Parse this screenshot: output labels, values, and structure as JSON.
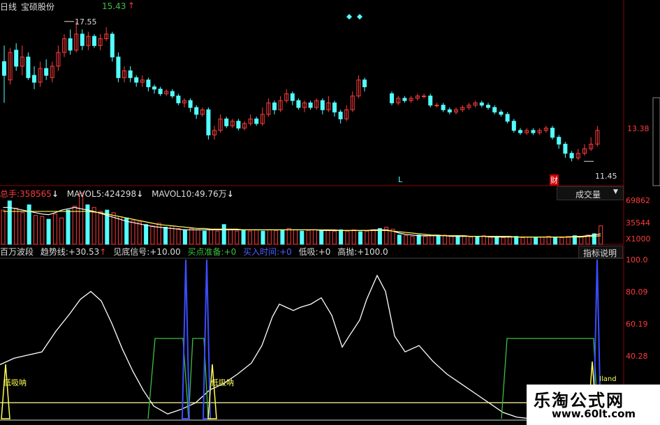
{
  "header": {
    "period": "日线",
    "stock": "宝硕股份",
    "price": "15.43",
    "arrow": "↑"
  },
  "price_pane": {
    "high_label": "17.55",
    "low_label": "11.45",
    "axis_label": "13.38",
    "marker_l": "L",
    "marker_cai": "财"
  },
  "volume_pane": {
    "total_label": "总手:",
    "total_value": "358565",
    "total_arrow": "↓",
    "mavol5_label": "MAVOL5:",
    "mavol5_value": "424298",
    "mavol5_arrow": "↓",
    "mavol10_label": "MAVOL10:",
    "mavol10_value": "49.76万",
    "mavol10_arrow": "↓",
    "dropdown": "成交量",
    "dropdown_icon": "▼",
    "axis": [
      "69862",
      "35544",
      "X1000"
    ]
  },
  "indicator_pane": {
    "name": "百万波段",
    "trend_label": "趋势线:",
    "trend_value": "+30.53",
    "trend_arrow": "↑",
    "signal_label": "见底信号:",
    "signal_value": "+10.00",
    "prepare_label": "买点准备:",
    "prepare_value": "+0",
    "buytime_label": "买入时间:",
    "buytime_value": "+0",
    "low_label": "低吸:",
    "low_value": "+0",
    "high_label": "高抛:",
    "high_value": "+100.0",
    "explain_button": "指标说明",
    "axis": [
      "100.0",
      "80.09",
      "60.19",
      "40.28"
    ],
    "annot_1": "低吸呐",
    "annot_2": "低吸呐",
    "bottom_text": "Iland"
  },
  "watermark": {
    "line1": "乐淘公式网",
    "line2": "www.60lt.com"
  },
  "colors": {
    "up": "#ff3b3b",
    "down": "#54ffff",
    "white": "#ffffff",
    "yellow": "#ffff54",
    "blue": "#3b4dff",
    "green": "#3fbf3f",
    "grid": "#8b0000"
  },
  "chart_data": [
    {
      "type": "candlestick",
      "name": "price",
      "ylim": [
        11.0,
        18.0
      ],
      "annotations": [
        "17.55",
        "11.45",
        "L",
        "财"
      ],
      "axis_ticks": [
        "13.38"
      ],
      "segment_a": [
        [
          15.8,
          15.2,
          16.5,
          14.0
        ],
        [
          15.0,
          16.2,
          16.4,
          14.8
        ],
        [
          16.3,
          15.6,
          16.6,
          15.4
        ],
        [
          15.6,
          16.0,
          16.5,
          15.2
        ],
        [
          16.0,
          15.1,
          16.2,
          15.0
        ],
        [
          15.2,
          14.9,
          15.6,
          14.6
        ],
        [
          14.9,
          15.5,
          15.8,
          14.7
        ],
        [
          15.5,
          15.2,
          15.9,
          15.0
        ],
        [
          15.1,
          15.6,
          15.8,
          14.9
        ],
        [
          15.6,
          16.2,
          16.5,
          15.4
        ],
        [
          16.2,
          16.8,
          17.0,
          16.0
        ],
        [
          16.8,
          16.3,
          17.2,
          16.1
        ],
        [
          16.3,
          17.0,
          17.55,
          16.2
        ],
        [
          17.0,
          16.5,
          17.2,
          16.3
        ],
        [
          16.5,
          16.9,
          17.1,
          16.3
        ],
        [
          16.9,
          16.5,
          17.0,
          16.4
        ],
        [
          16.5,
          16.8,
          17.0,
          16.3
        ],
        [
          16.8,
          17.0,
          17.3,
          16.7
        ],
        [
          17.0,
          16.0,
          17.1,
          15.8
        ],
        [
          16.0,
          15.1,
          16.2,
          14.9
        ],
        [
          15.1,
          15.4,
          15.6,
          14.9
        ],
        [
          15.4,
          15.1,
          15.6,
          14.9
        ],
        [
          15.1,
          14.9,
          15.2,
          14.7
        ],
        [
          14.9,
          15.0,
          15.2,
          14.7
        ],
        [
          15.0,
          14.7,
          15.1,
          14.5
        ],
        [
          14.7,
          14.6,
          14.8,
          14.4
        ],
        [
          14.6,
          14.4,
          14.7,
          14.3
        ],
        [
          14.4,
          14.5,
          14.6,
          14.3
        ],
        [
          14.5,
          14.3,
          14.6,
          14.2
        ],
        [
          14.3,
          14.0,
          14.4,
          13.9
        ],
        [
          14.0,
          14.1,
          14.2,
          13.8
        ],
        [
          14.1,
          13.8,
          14.2,
          13.6
        ],
        [
          13.8,
          13.5,
          13.9,
          13.3
        ],
        [
          13.5,
          13.7,
          13.8,
          13.4
        ],
        [
          13.7,
          12.6,
          13.8,
          12.4
        ],
        [
          12.6,
          12.8,
          13.0,
          12.4
        ],
        [
          12.8,
          13.3,
          13.5,
          12.7
        ],
        [
          13.3,
          13.0,
          13.4,
          12.9
        ],
        [
          13.0,
          13.2,
          13.3,
          12.9
        ],
        [
          13.2,
          12.9,
          13.3,
          12.8
        ],
        [
          12.9,
          13.1,
          13.2,
          12.8
        ],
        [
          13.1,
          13.3,
          13.5,
          13.0
        ],
        [
          13.3,
          13.1,
          13.4,
          13.0
        ],
        [
          13.1,
          13.5,
          13.8,
          13.0
        ],
        [
          13.5,
          14.0,
          14.2,
          13.4
        ],
        [
          14.0,
          13.7,
          14.1,
          13.5
        ],
        [
          13.7,
          14.1,
          14.3,
          13.6
        ],
        [
          14.1,
          14.4,
          14.6,
          14.0
        ],
        [
          14.4,
          14.1,
          14.5,
          13.9
        ],
        [
          14.1,
          13.8,
          14.2,
          13.7
        ],
        [
          13.8,
          14.0,
          14.1,
          13.6
        ],
        [
          14.0,
          13.8,
          14.1,
          13.7
        ],
        [
          13.8,
          14.1,
          14.2,
          13.7
        ],
        [
          14.1,
          13.7,
          14.2,
          13.5
        ],
        [
          13.7,
          14.0,
          14.3,
          13.6
        ],
        [
          14.0,
          13.6,
          14.1,
          13.4
        ],
        [
          13.6,
          13.3,
          13.7,
          13.1
        ],
        [
          13.3,
          13.7,
          13.9,
          13.2
        ],
        [
          13.7,
          14.3,
          14.5,
          13.6
        ],
        [
          14.3,
          15.0,
          15.2,
          14.2
        ],
        [
          15.0,
          14.7,
          15.1,
          14.5
        ]
      ],
      "segment_b": [
        [
          14.4,
          14.0,
          14.5,
          13.9
        ],
        [
          14.0,
          14.2,
          14.3,
          13.9
        ],
        [
          14.2,
          14.1,
          14.3,
          14.0
        ],
        [
          14.1,
          14.2,
          14.3,
          14.0
        ],
        [
          14.2,
          14.3,
          14.4,
          14.1
        ],
        [
          14.3,
          14.3,
          14.4,
          14.2
        ],
        [
          14.3,
          13.9,
          14.4,
          13.8
        ],
        [
          13.9,
          13.9,
          14.0,
          13.8
        ],
        [
          13.9,
          13.7,
          14.0,
          13.6
        ],
        [
          13.7,
          13.6,
          13.8,
          13.5
        ],
        [
          13.6,
          13.7,
          13.8,
          13.5
        ],
        [
          13.7,
          13.8,
          13.9,
          13.6
        ],
        [
          13.8,
          13.9,
          14.0,
          13.7
        ],
        [
          13.9,
          14.0,
          14.1,
          13.8
        ],
        [
          14.0,
          13.9,
          14.1,
          13.8
        ],
        [
          13.9,
          13.8,
          14.0,
          13.7
        ],
        [
          13.8,
          13.6,
          13.9,
          13.5
        ],
        [
          13.6,
          13.5,
          13.7,
          13.4
        ],
        [
          13.5,
          13.2,
          13.6,
          13.1
        ],
        [
          13.2,
          12.8,
          13.3,
          12.7
        ],
        [
          12.8,
          12.7,
          12.9,
          12.6
        ],
        [
          12.7,
          12.8,
          12.9,
          12.6
        ],
        [
          12.8,
          12.7,
          12.9,
          12.6
        ],
        [
          12.7,
          12.8,
          12.9,
          12.6
        ],
        [
          12.8,
          12.9,
          13.0,
          12.7
        ],
        [
          12.9,
          12.5,
          13.0,
          12.4
        ],
        [
          12.5,
          12.2,
          12.6,
          12.0
        ],
        [
          12.2,
          11.8,
          12.3,
          11.6
        ],
        [
          11.8,
          11.6,
          11.9,
          11.45
        ],
        [
          11.6,
          11.8,
          12.0,
          11.5
        ],
        [
          11.8,
          12.0,
          12.2,
          11.7
        ],
        [
          12.0,
          12.2,
          12.5,
          11.9
        ],
        [
          12.2,
          12.8,
          13.0,
          12.1
        ]
      ]
    },
    {
      "type": "bar",
      "name": "volume",
      "ylim": [
        0,
        85000
      ],
      "axis_ticks": [
        "69862",
        "35544",
        "X1000"
      ],
      "values": [
        52000,
        66000,
        55000,
        48000,
        60000,
        44000,
        42000,
        38000,
        46000,
        40000,
        52000,
        58000,
        78000,
        60000,
        56000,
        50000,
        52000,
        48000,
        42000,
        40000,
        36000,
        34000,
        30000,
        28000,
        32000,
        26000,
        28000,
        24000,
        22000,
        24000,
        22000,
        20000,
        22000,
        20000,
        30000,
        22000,
        20000,
        22000,
        20000,
        22000,
        20000,
        22000,
        21000,
        22000,
        24000,
        22000,
        20000,
        21000,
        22000,
        20000,
        21000,
        20000,
        22000,
        20000,
        22000,
        19000,
        20000,
        22000,
        24000,
        26000,
        23000,
        14000,
        13000,
        12000,
        14000,
        12000,
        13000,
        12000,
        14000,
        12000,
        13000,
        12000,
        11000,
        12000,
        13000,
        11000,
        12000,
        10000,
        11000,
        12000,
        10000,
        11000,
        10000,
        11000,
        12000,
        11000,
        10000,
        12000,
        13000,
        11000,
        14000,
        16000,
        28000
      ],
      "mavol5": [
        56000,
        56000,
        54000,
        52000,
        50000,
        48000,
        46000,
        45000,
        48000,
        52000,
        54000,
        56000,
        54000,
        52000,
        50000,
        47000,
        44000,
        41000,
        38000,
        35000,
        33000,
        31000,
        29000,
        27000,
        26000,
        25000,
        24000,
        23000,
        22000,
        22000,
        22000,
        22000,
        22000,
        22000,
        22000,
        22000,
        22000,
        22000,
        22000,
        22000,
        22000,
        22000,
        22000,
        22000,
        22000,
        22000,
        22000,
        22000,
        22000,
        21000,
        21000,
        21000,
        21000,
        21000,
        21000,
        21000,
        21000,
        22000,
        22000,
        22000,
        20000,
        17000,
        15000,
        14000,
        13000,
        13000,
        13000,
        13000,
        13000,
        12000,
        12000,
        12000,
        12000,
        12000,
        12000,
        11000,
        11000,
        11000,
        11000,
        11000,
        11000,
        11000,
        11000,
        11000,
        11000,
        11000,
        11000,
        11000,
        12000,
        12000,
        13000,
        14000,
        16000
      ],
      "mavol10": [
        50000,
        50000,
        50000,
        50000,
        50000,
        50000,
        50000,
        50000,
        50000,
        50000,
        50000,
        50000,
        50000,
        50000,
        49000,
        48000,
        46000,
        44000,
        42000,
        40000,
        38000,
        36000,
        34000,
        32000,
        30000,
        29000,
        28000,
        27000,
        26000,
        25000,
        24000,
        24000,
        23000,
        23000,
        23000,
        23000,
        23000,
        22000,
        22000,
        22000,
        22000,
        22000,
        22000,
        22000,
        22000,
        22000,
        22000,
        22000,
        22000,
        22000,
        22000,
        22000,
        21000,
        21000,
        21000,
        21000,
        21000,
        21000,
        21000,
        21000,
        20000,
        19000,
        18000,
        17000,
        16000,
        15000,
        14000,
        14000,
        13000,
        13000,
        13000,
        13000,
        12000,
        12000,
        12000,
        12000,
        12000,
        12000,
        12000,
        11000,
        11000,
        11000,
        11000,
        11000,
        11000,
        11000,
        11000,
        11000,
        11000,
        11000,
        12000,
        12000,
        13000
      ]
    },
    {
      "type": "line",
      "name": "百万波段",
      "ylim": [
        0,
        100
      ],
      "axis_ticks": [
        "100.0",
        "80.09",
        "60.19",
        "40.28"
      ],
      "series": [
        {
          "name": "趋势线",
          "color": "#ffffff",
          "values": [
            [
              0,
              34
            ],
            [
              20,
              38
            ],
            [
              40,
              40
            ],
            [
              60,
              42
            ],
            [
              80,
              55
            ],
            [
              100,
              66
            ],
            [
              115,
              75
            ],
            [
              130,
              80
            ],
            [
              145,
              74
            ],
            [
              160,
              60
            ],
            [
              175,
              44
            ],
            [
              190,
              30
            ],
            [
              205,
              18
            ],
            [
              220,
              8
            ],
            [
              240,
              3
            ],
            [
              260,
              6
            ],
            [
              280,
              10
            ],
            [
              300,
              18
            ],
            [
              320,
              22
            ],
            [
              340,
              28
            ],
            [
              360,
              35
            ],
            [
              375,
              46
            ],
            [
              390,
              64
            ],
            [
              400,
              72
            ],
            [
              410,
              70
            ],
            [
              420,
              68
            ],
            [
              430,
              70
            ],
            [
              445,
              72
            ],
            [
              460,
              76
            ],
            [
              475,
              65
            ],
            [
              490,
              45
            ],
            [
              500,
              52
            ],
            [
              515,
              62
            ],
            [
              525,
              75
            ],
            [
              540,
              90
            ],
            [
              552,
              80
            ],
            [
              565,
              52
            ],
            [
              580,
              42
            ],
            [
              600,
              46
            ],
            [
              620,
              36
            ],
            [
              640,
              28
            ],
            [
              660,
              22
            ],
            [
              680,
              16
            ],
            [
              700,
              10
            ],
            [
              720,
              4
            ],
            [
              740,
              1
            ],
            [
              760,
              0
            ]
          ]
        },
        {
          "name": "见底信号",
          "color": "#ffffff",
          "values": [
            [
              0,
              14
            ],
            [
              900,
              14
            ]
          ]
        }
      ]
    }
  ]
}
